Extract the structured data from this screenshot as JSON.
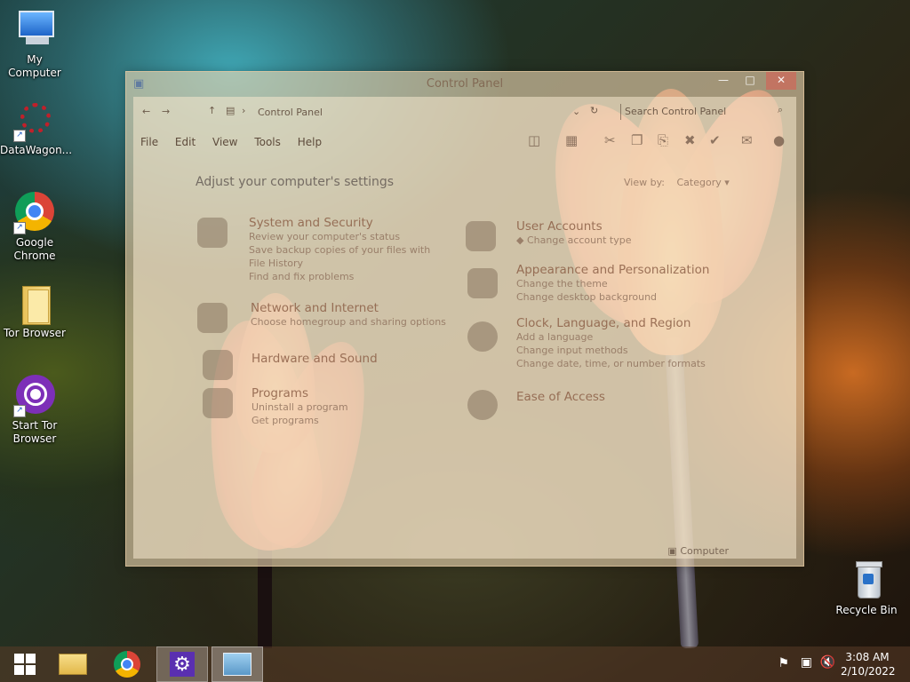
{
  "desktop": {
    "icons": [
      {
        "label": "My Computer"
      },
      {
        "label": "DataWagon..."
      },
      {
        "label": "Google Chrome"
      },
      {
        "label": "Tor Browser"
      },
      {
        "label": "Start Tor Browser"
      },
      {
        "label": "Recycle Bin"
      }
    ]
  },
  "window": {
    "title": "Control Panel",
    "address": "Control Panel",
    "search_placeholder": "Search Control Panel",
    "menu": [
      "File",
      "Edit",
      "View",
      "Tools",
      "Help"
    ],
    "heading": "Adjust your computer's settings",
    "view_by_label": "View by:",
    "view_by_value": "Category",
    "categories": [
      {
        "title": "System and Security",
        "links": [
          "Review your computer's status",
          "Save backup copies of your files with File History",
          "Find and fix problems"
        ]
      },
      {
        "title": "Network and Internet",
        "links": [
          "Choose homegroup and sharing options"
        ]
      },
      {
        "title": "Hardware and Sound",
        "links": []
      },
      {
        "title": "Programs",
        "links": [
          "Uninstall a program",
          "Get programs"
        ]
      },
      {
        "title": "User Accounts",
        "links": [
          "Change account type"
        ]
      },
      {
        "title": "Appearance and Personalization",
        "links": [
          "Change the theme",
          "Change desktop background"
        ]
      },
      {
        "title": "Clock, Language, and Region",
        "links": [
          "Add a language",
          "Change input methods",
          "Change date, time, or number formats"
        ]
      },
      {
        "title": "Ease of Access",
        "links": []
      }
    ],
    "status": "Computer"
  },
  "taskbar": {
    "time": "3:08 AM",
    "date": "2/10/2022"
  }
}
